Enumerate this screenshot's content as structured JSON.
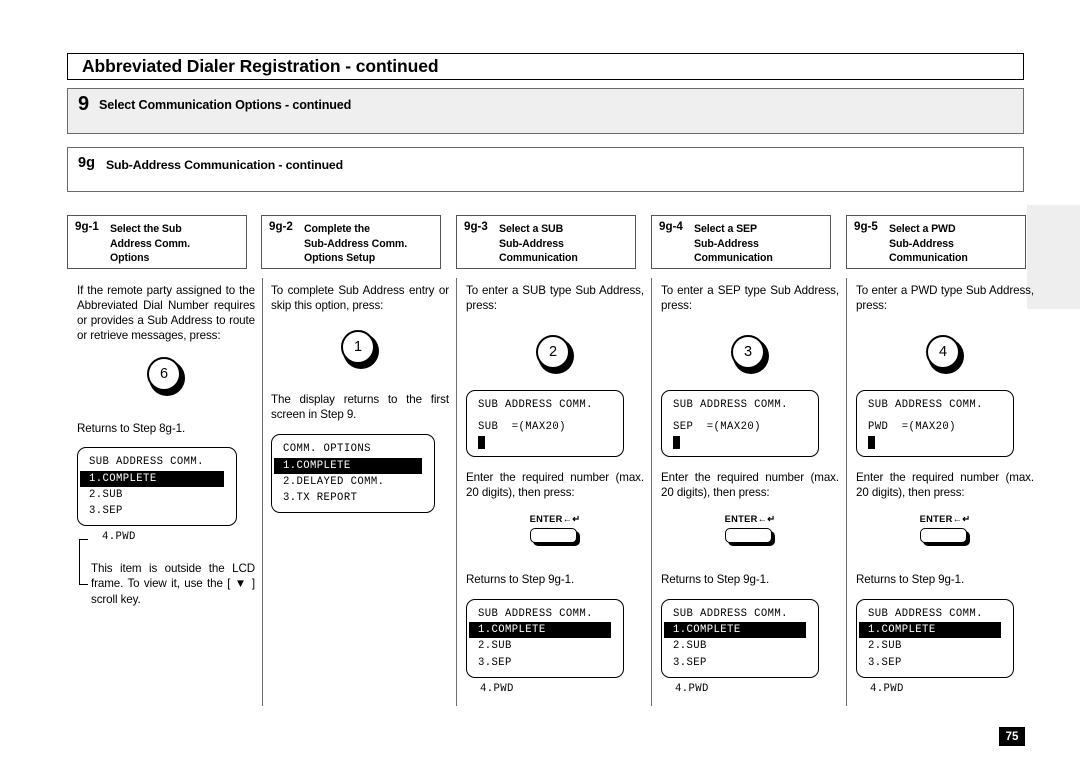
{
  "title": "Abbreviated Dialer Registration - continued",
  "step": {
    "number": "9",
    "label": "Select Communication Options - continued"
  },
  "substep": {
    "number": "9g",
    "label": "Sub-Address Communication - continued"
  },
  "page_number": "75",
  "columns": [
    {
      "head_num": "9g-1",
      "head_text": "Select the Sub\nAddress Comm.\nOptions",
      "intro": "If the remote party assigned to the Abbreviated Dial Number requires or provides a Sub Address to route or retrieve messages, press:",
      "key": "6",
      "returns": "Returns to Step 8g-1.",
      "lcd": {
        "title": "SUB ADDRESS COMM.",
        "rows": [
          "1.COMPLETE",
          "2.SUB",
          "3.SEP"
        ],
        "highlight_index": 0
      },
      "outside_row": "4.PWD",
      "note": "This item is outside the LCD frame. To view it, use the [ ▼ ] scroll key."
    },
    {
      "head_num": "9g-2",
      "head_text": "Complete the\nSub-Address Comm.\nOptions Setup",
      "intro": "To complete Sub Address entry or skip this option, press:",
      "key": "1",
      "after_key": "The display returns to the first screen in Step 9.",
      "lcd": {
        "title": "COMM. OPTIONS",
        "rows": [
          "1.COMPLETE",
          "2.DELAYED COMM.",
          "3.TX REPORT"
        ],
        "highlight_index": 0
      }
    },
    {
      "head_num": "9g-3",
      "head_text": "Select a SUB\nSub-Address\nCommunication",
      "intro": "To enter a SUB type Sub Address, press:",
      "key": "2",
      "entry_lcd": {
        "title": "SUB ADDRESS COMM.",
        "field": "SUB  =(MAX20)"
      },
      "instruction": "Enter the required number (max. 20 digits), then press:",
      "enter_label": "ENTER",
      "returns": "Returns to Step 9g-1.",
      "lcd": {
        "title": "SUB ADDRESS COMM.",
        "rows": [
          "1.COMPLETE",
          "2.SUB",
          "3.SEP"
        ],
        "highlight_index": 0
      },
      "outside_row": "4.PWD"
    },
    {
      "head_num": "9g-4",
      "head_text": "Select a SEP\nSub-Address\nCommunication",
      "intro": "To enter a SEP type Sub Address, press:",
      "key": "3",
      "entry_lcd": {
        "title": "SUB ADDRESS COMM.",
        "field": "SEP  =(MAX20)"
      },
      "instruction": "Enter the required number (max. 20 digits), then press:",
      "enter_label": "ENTER",
      "returns": "Returns to Step 9g-1.",
      "lcd": {
        "title": "SUB ADDRESS COMM.",
        "rows": [
          "1.COMPLETE",
          "2.SUB",
          "3.SEP"
        ],
        "highlight_index": 0
      },
      "outside_row": "4.PWD"
    },
    {
      "head_num": "9g-5",
      "head_text": "Select a PWD\nSub-Address\nCommunication",
      "intro": "To enter a PWD type Sub Address, press:",
      "key": "4",
      "entry_lcd": {
        "title": "SUB ADDRESS COMM.",
        "field": "PWD  =(MAX20)"
      },
      "instruction": "Enter the required number (max. 20 digits), then press:",
      "enter_label": "ENTER",
      "returns": "Returns to Step 9g-1.",
      "lcd": {
        "title": "SUB ADDRESS COMM.",
        "rows": [
          "1.COMPLETE",
          "2.SUB",
          "3.SEP"
        ],
        "highlight_index": 0
      },
      "outside_row": "4.PWD"
    }
  ]
}
